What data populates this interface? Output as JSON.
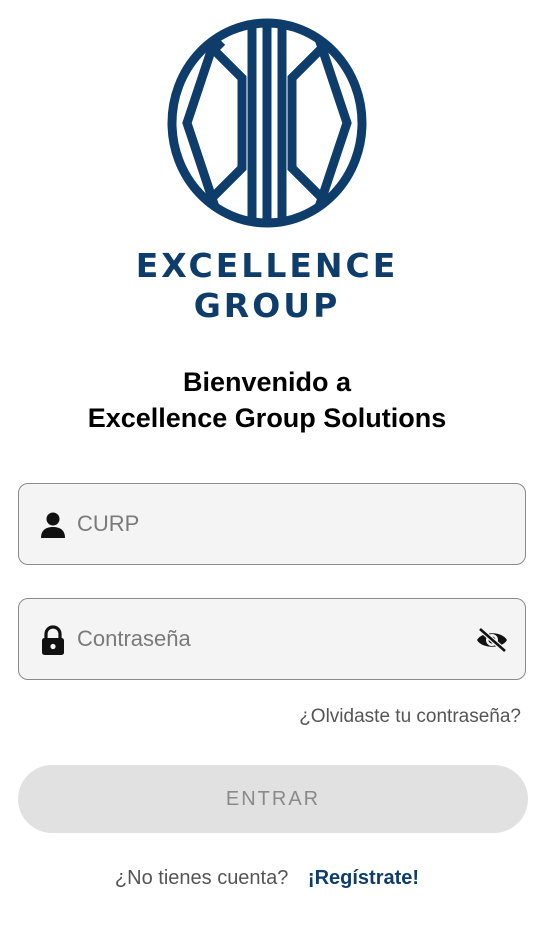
{
  "brand": {
    "line1": "EXCELLENCE",
    "line2": "GROUP",
    "color": "#0f3d6b"
  },
  "welcome": {
    "line1": "Bienvenido a",
    "line2": "Excellence Group Solutions"
  },
  "form": {
    "curp": {
      "placeholder": "CURP",
      "value": "",
      "icon": "person-icon"
    },
    "password": {
      "placeholder": "Contraseña",
      "value": "",
      "icon": "lock-icon",
      "toggle_icon": "eye-off-icon"
    },
    "forgot_label": "¿Olvidaste tu contraseña?",
    "submit_label": "ENTRAR"
  },
  "signup": {
    "question": "¿No tienes cuenta?",
    "link_label": "¡Regístrate!"
  },
  "colors": {
    "accent": "#0f3d6b",
    "field_bg": "#f4f4f4",
    "button_disabled_bg": "#e1e1e1",
    "button_disabled_text": "#8a8a8a"
  }
}
